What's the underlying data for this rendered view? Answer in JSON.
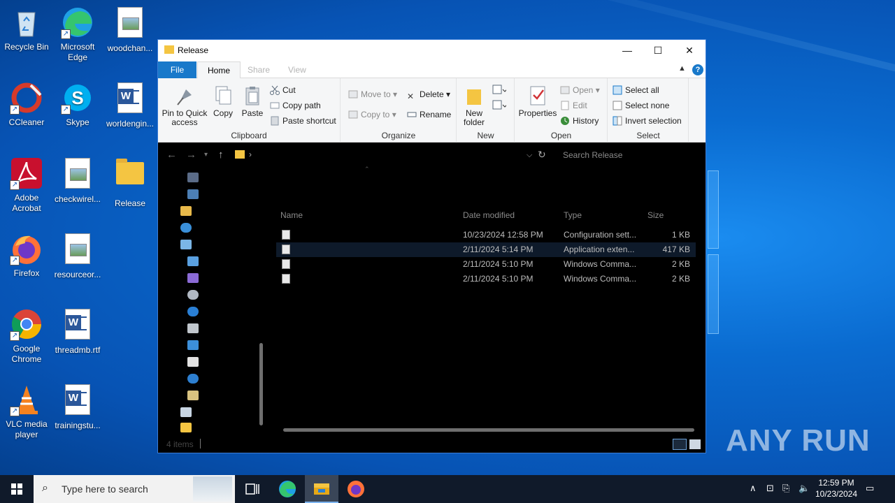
{
  "desktop": {
    "icons": [
      {
        "label": "Recycle Bin"
      },
      {
        "label": "Microsoft Edge"
      },
      {
        "label": "woodchan..."
      },
      {
        "label": "CCleaner"
      },
      {
        "label": "Skype"
      },
      {
        "label": "worldengin..."
      },
      {
        "label": "Adobe Acrobat"
      },
      {
        "label": "checkwirel..."
      },
      {
        "label": "Release"
      },
      {
        "label": "Firefox"
      },
      {
        "label": "resourceor..."
      },
      {
        "label": "Google Chrome"
      },
      {
        "label": "threadmb.rtf"
      },
      {
        "label": "VLC media player"
      },
      {
        "label": "trainingstu..."
      }
    ],
    "watermark": "ANY RUN"
  },
  "window": {
    "title": "Release",
    "minimize": "—",
    "maximize": "☐",
    "close": "✕"
  },
  "ribbon": {
    "tabs": [
      "File",
      "Home",
      "Share",
      "View"
    ],
    "clipboard": {
      "pin": "Pin to Quick access",
      "copy": "Copy",
      "paste": "Paste",
      "cut": "Cut",
      "copy_path": "Copy path",
      "paste_shortcut": "Paste shortcut",
      "label": "Clipboard"
    },
    "organize": {
      "move_to": "Move to",
      "copy_to": "Copy to",
      "delete": "Delete",
      "rename": "Rename",
      "label": "Organize"
    },
    "new": {
      "new_folder": "New folder",
      "label": "New"
    },
    "open": {
      "properties": "Properties",
      "open": "Open",
      "edit": "Edit",
      "history": "History",
      "label": "Open"
    },
    "select": {
      "select_all": "Select all",
      "select_none": "Select none",
      "invert": "Invert selection",
      "label": "Select"
    }
  },
  "address": {
    "search_placeholder": "Search Release"
  },
  "columns": [
    "Name",
    "Date modified",
    "Type",
    "Size"
  ],
  "files": [
    {
      "name": "",
      "date": "10/23/2024 12:58 PM",
      "type": "Configuration sett...",
      "size": "1 KB"
    },
    {
      "name": "",
      "date": "2/11/2024 5:14 PM",
      "type": "Application exten...",
      "size": "417 KB"
    },
    {
      "name": "",
      "date": "2/11/2024 5:10 PM",
      "type": "Windows Comma...",
      "size": "2 KB"
    },
    {
      "name": "",
      "date": "2/11/2024 5:10 PM",
      "type": "Windows Comma...",
      "size": "2 KB"
    }
  ],
  "status": {
    "items": "4 items"
  },
  "taskbar": {
    "search_placeholder": "Type here to search",
    "time": "12:59 PM",
    "date": "10/23/2024"
  },
  "colors": {
    "accent": "#1979ca",
    "taskbar": "#101a2a",
    "folder": "#f4c542"
  }
}
